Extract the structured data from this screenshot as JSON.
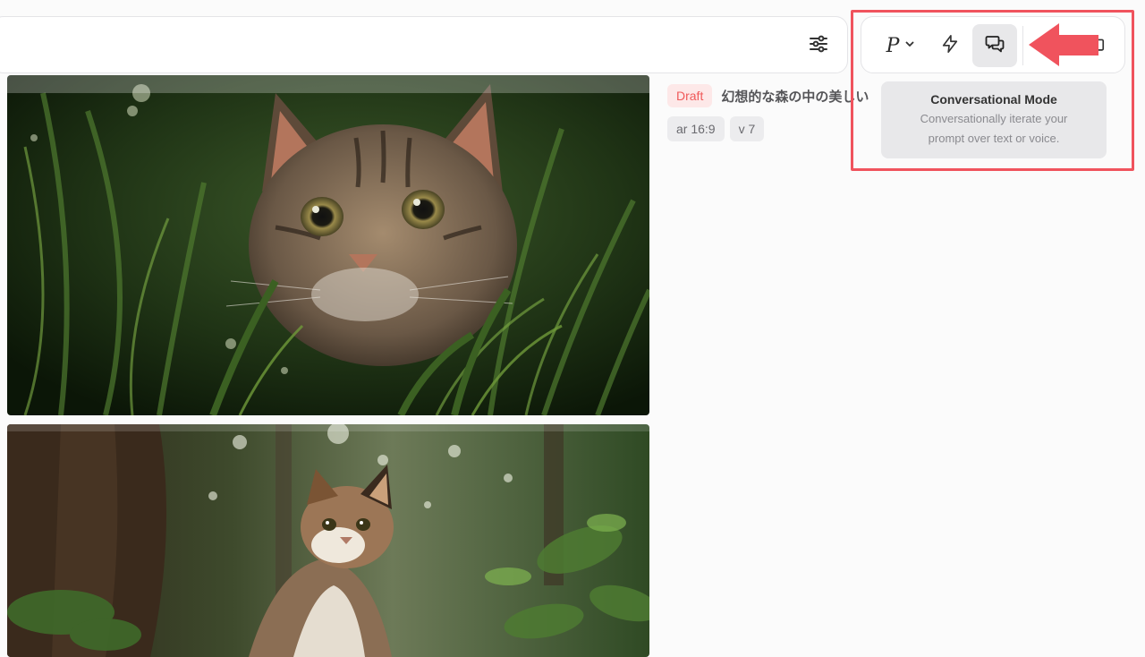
{
  "prompt_bar": {
    "settings_icon": "sliders-icon"
  },
  "toolbar": {
    "personalize_label": "P",
    "icons": [
      "chevron-down-icon",
      "lightning-icon",
      "chat-bubbles-icon",
      "folder-icon"
    ]
  },
  "tooltip": {
    "title": "Conversational Mode",
    "description_line1": "Conversationally iterate your",
    "description_line2": "prompt over text or voice."
  },
  "job": {
    "badge": "Draft",
    "prompt": "幻想的な森の中の美しい",
    "tags": [
      "ar 16:9",
      "v 7"
    ]
  },
  "images": [
    {
      "subject": "tabby-cat-in-grass"
    },
    {
      "subject": "calico-cat-in-forest"
    }
  ],
  "colors": {
    "highlight": "#f0535d",
    "draft_badge_bg": "#fde8e8",
    "draft_badge_text": "#f05a5a"
  }
}
